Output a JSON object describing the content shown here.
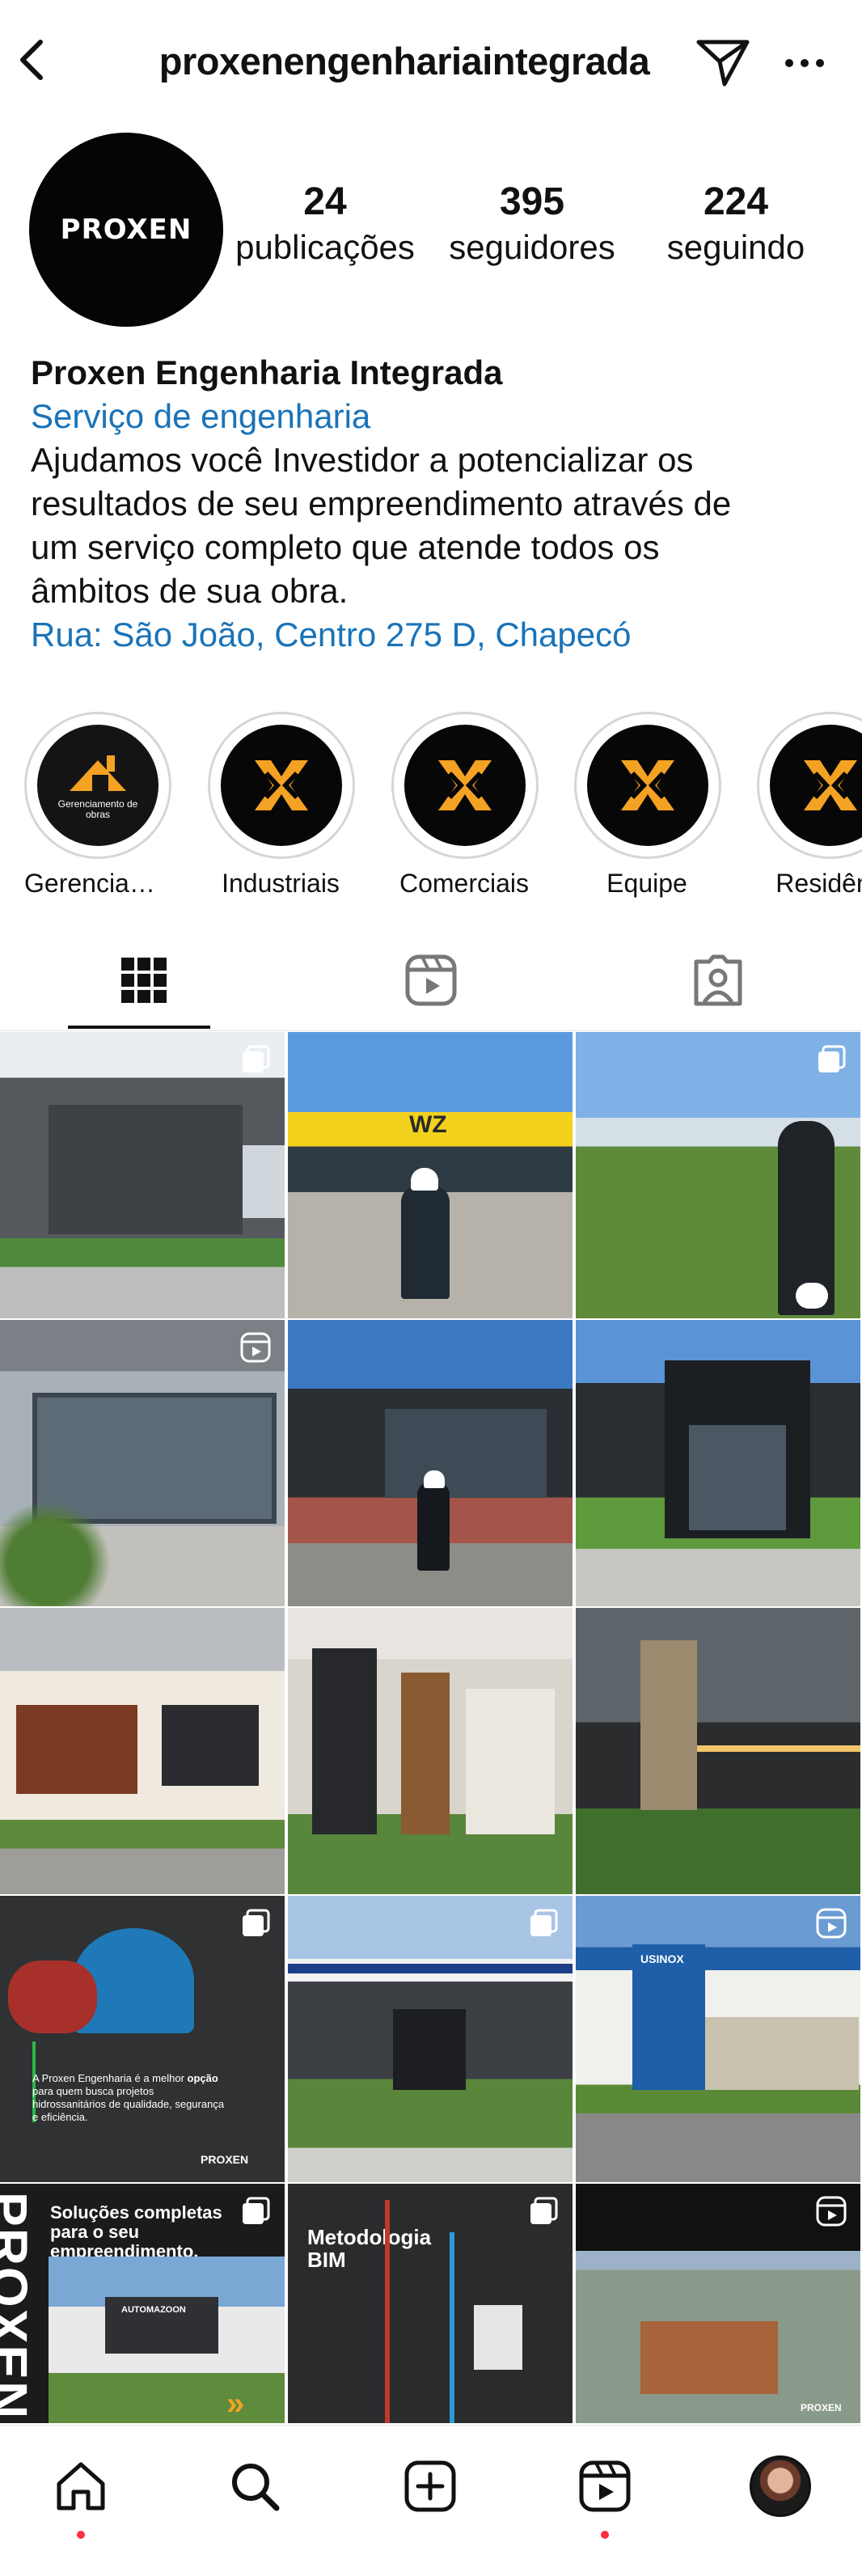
{
  "header": {
    "username": "proxenengenhariaintegrada",
    "back_icon": "chevron-left-icon",
    "send_icon": "paper-plane-icon",
    "more_icon": "more-horizontal-icon"
  },
  "profile": {
    "avatar_text": "PROXEN",
    "stats": [
      {
        "value": "24",
        "label": "publicações"
      },
      {
        "value": "395",
        "label": "seguidores"
      },
      {
        "value": "224",
        "label": "seguindo"
      }
    ]
  },
  "bio": {
    "name": "Proxen Engenharia Integrada",
    "category": "Serviço de engenharia",
    "text": "Ajudamos você Investidor a potencializar os\nresultados de seu empreendimento através de\num serviço completo que atende todos os\nâmbitos de sua obra.",
    "location": "Rua: São João, Centro 275 D, Chapecó"
  },
  "highlights": [
    {
      "label": "Gerenciame...",
      "cover_text": "Gerenciamento de obras"
    },
    {
      "label": "Industriais"
    },
    {
      "label": "Comerciais"
    },
    {
      "label": "Equipe"
    },
    {
      "label": "Residênc"
    }
  ],
  "tabs": [
    {
      "name": "grid",
      "icon": "grid-icon"
    },
    {
      "name": "reels",
      "icon": "reels-icon"
    },
    {
      "name": "tagged",
      "icon": "tagged-person-icon"
    }
  ],
  "posts": [
    {
      "badge": "carousel"
    },
    {
      "badge": "",
      "sign": "WZ"
    },
    {
      "badge": "carousel"
    },
    {
      "badge": "reel"
    },
    {
      "badge": ""
    },
    {
      "badge": ""
    },
    {
      "badge": ""
    },
    {
      "badge": ""
    },
    {
      "badge": ""
    },
    {
      "badge": "carousel",
      "caption_prefix": "A Proxen Engenharia é a melhor",
      "caption_bold": "opção",
      "caption_rest": " para quem busca projetos hidrossanitários de qualidade, segurança e eficiência.",
      "logo": "PROXEN"
    },
    {
      "badge": "carousel"
    },
    {
      "badge": "reel",
      "sign": "USINOX"
    },
    {
      "badge": "carousel",
      "headline": "Soluções completas para o seu empreendimento.",
      "side_text": "PROXEN",
      "sign": "AUTOMAZOON"
    },
    {
      "badge": "carousel",
      "headline": "Metodologia BIM"
    },
    {
      "badge": "reel",
      "logo": "PROXEN"
    }
  ],
  "nav": [
    {
      "name": "home",
      "icon": "home-icon"
    },
    {
      "name": "search",
      "icon": "search-icon"
    },
    {
      "name": "create",
      "icon": "plus-square-icon"
    },
    {
      "name": "reels",
      "icon": "reels-icon"
    },
    {
      "name": "profile",
      "icon": "profile-avatar-icon"
    }
  ],
  "colors": {
    "link": "#1a73b8",
    "accent_orange": "#f4a223",
    "notification": "#ff3040"
  }
}
